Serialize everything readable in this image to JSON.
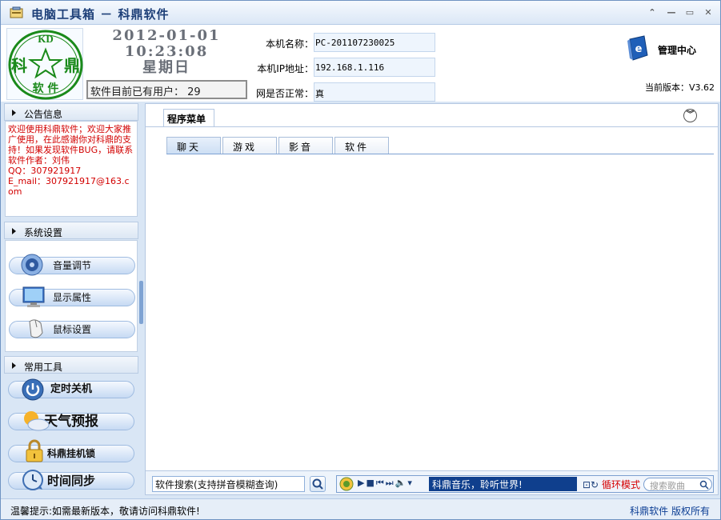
{
  "window": {
    "title": "电脑工具箱 － 科鼎软件",
    "controls": [
      "minimize",
      "restore",
      "maximize",
      "close"
    ]
  },
  "header": {
    "logo": {
      "top_char": "KD",
      "left_char": "科",
      "right_char": "鼎",
      "bottom_text": "软 件"
    },
    "date": "2012-01-01",
    "time": "10:23:08",
    "weekday": "星期日",
    "user_count_label": "软件目前已有用户： 29",
    "info": [
      {
        "label": "本机名称：",
        "value": "PC-201107230025"
      },
      {
        "label": "本机IP地址：",
        "value": "192.168.1.116"
      },
      {
        "label": "网是否正常：",
        "value": "真"
      }
    ],
    "manager_label": "管理中心",
    "version": "当前版本：V3.62"
  },
  "sidebar": {
    "notice": {
      "title": "公告信息",
      "text": "欢迎使用科鼎软件；欢迎大家推广使用，在此感谢你对科鼎的支持！如果发现软件BUG，请联系软件作者：刘伟",
      "qq": " QQ：307921917",
      "email": " E_mail：307921917@163.com"
    },
    "settings": {
      "title": "系统设置",
      "items": [
        "音量调节",
        "显示属性",
        "鼠标设置"
      ]
    },
    "tools": {
      "title": "常用工具",
      "items": [
        "定时关机",
        "天气预报",
        "科鼎挂机锁",
        "时间同步"
      ]
    }
  },
  "main": {
    "tab_label": "程序菜单",
    "categories": [
      "聊天",
      "游戏",
      "影音",
      "软件"
    ],
    "active_category": 0
  },
  "bottombar": {
    "search_value": "软件搜索(支持拼音模糊查询)",
    "music_title": "科鼎音乐，聆听世界!",
    "music_mode": "循环模式",
    "music_search_placeholder": "搜索歌曲"
  },
  "statusbar": {
    "tip": "温馨提示:如需最新版本，敬请访问科鼎软件!",
    "copyright": "科鼎软件 版权所有"
  },
  "colors": {
    "accent": "#1d3f78",
    "notice_red": "#d20000",
    "logo_green": "#1a8a1a",
    "link_blue": "#0b3d94"
  }
}
